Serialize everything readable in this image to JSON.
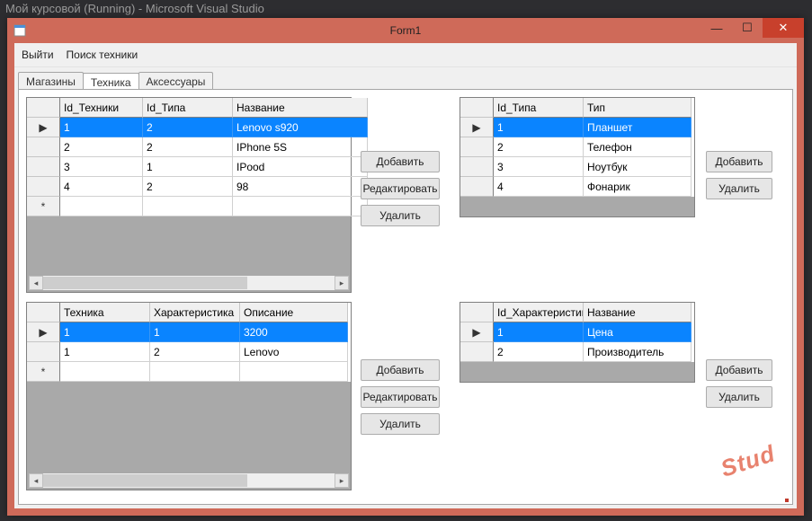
{
  "vs_title": "Мой курсовой (Running) - Microsoft Visual Studio",
  "window": {
    "title": "Form1"
  },
  "menu": {
    "exit": "Выйти",
    "search": "Поиск техники"
  },
  "tabs": {
    "stores": "Магазины",
    "tech": "Техника",
    "accessories": "Аксессуары"
  },
  "buttons": {
    "add": "Добавить",
    "edit": "Редактировать",
    "delete": "Удалить"
  },
  "grid1": {
    "headers": [
      "Id_Техники",
      "Id_Типа",
      "Название"
    ],
    "rows": [
      {
        "c": [
          "1",
          "2",
          "Lenovo s920"
        ],
        "selected": true,
        "indicator": "▶"
      },
      {
        "c": [
          "2",
          "2",
          "IPhone 5S"
        ]
      },
      {
        "c": [
          "3",
          "1",
          "IPood"
        ]
      },
      {
        "c": [
          "4",
          "2",
          "98"
        ]
      }
    ]
  },
  "grid2": {
    "headers": [
      "Id_Типа",
      "Тип"
    ],
    "rows": [
      {
        "c": [
          "1",
          "Планшет"
        ],
        "selected": true,
        "indicator": "▶"
      },
      {
        "c": [
          "2",
          "Телефон"
        ]
      },
      {
        "c": [
          "3",
          "Ноутбук"
        ]
      },
      {
        "c": [
          "4",
          "Фонарик"
        ]
      }
    ]
  },
  "grid3": {
    "headers": [
      "Техника",
      "Характеристика",
      "Описание"
    ],
    "rows": [
      {
        "c": [
          "1",
          "1",
          "3200"
        ],
        "selected": true,
        "indicator": "▶"
      },
      {
        "c": [
          "1",
          "2",
          "Lenovo"
        ]
      }
    ]
  },
  "grid4": {
    "headers": [
      "Id_Характеристик",
      "Название"
    ],
    "rows": [
      {
        "c": [
          "1",
          "Цена"
        ],
        "selected": true,
        "indicator": "▶"
      },
      {
        "c": [
          "2",
          "Производитель"
        ]
      }
    ]
  },
  "watermark": "Stud"
}
